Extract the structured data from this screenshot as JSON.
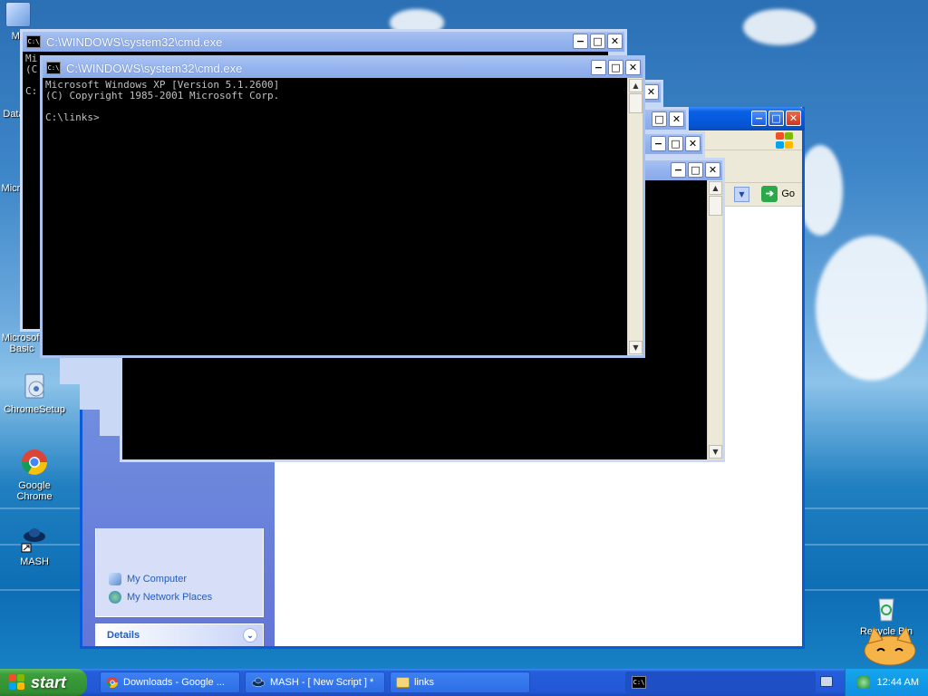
{
  "desktop": {
    "icons": [
      {
        "label": "My",
        "name": "my-computer"
      },
      {
        "label": "Data",
        "name": "data"
      },
      {
        "label": "Micro",
        "name": "microsoft-a"
      },
      {
        "label": "Microsoft Basic",
        "name": "microsoft-basic"
      },
      {
        "label": "ChromeSetup",
        "name": "chromesetup"
      },
      {
        "label": "Google Chrome",
        "name": "google-chrome"
      },
      {
        "label": "MASH",
        "name": "mash"
      },
      {
        "label": "Recycle Bin",
        "name": "recycle-bin"
      }
    ]
  },
  "cmd_windows": [
    {
      "title": "C:\\WINDOWS\\system32\\cmd.exe"
    },
    {
      "title": "C:\\WINDOWS\\system32\\cmd.exe"
    }
  ],
  "console": {
    "lines": "Microsoft Windows XP [Version 5.1.2600]\n(C) Copyright 1985-2001 Microsoft Corp.\n\nC:\\links>",
    "back_fragment": "Mi\n(C\n\nC:"
  },
  "title_buttons": {
    "minimize": "−",
    "maximize": "□",
    "close": "✕"
  },
  "explorer": {
    "go_label": "Go",
    "places": [
      {
        "label": "My Computer"
      },
      {
        "label": "My Network Places"
      }
    ],
    "details_label": "Details"
  },
  "taskbar": {
    "start_label": "start",
    "tasks": [
      {
        "label": "Downloads - Google ..."
      },
      {
        "label": "MASH - [ New Script ] *"
      },
      {
        "label": "links"
      }
    ],
    "clock": "12:44 AM"
  },
  "colors": {
    "xp_blue": "#0a5fd8",
    "console_bg": "#000000",
    "console_fg": "#c0c0c0"
  }
}
